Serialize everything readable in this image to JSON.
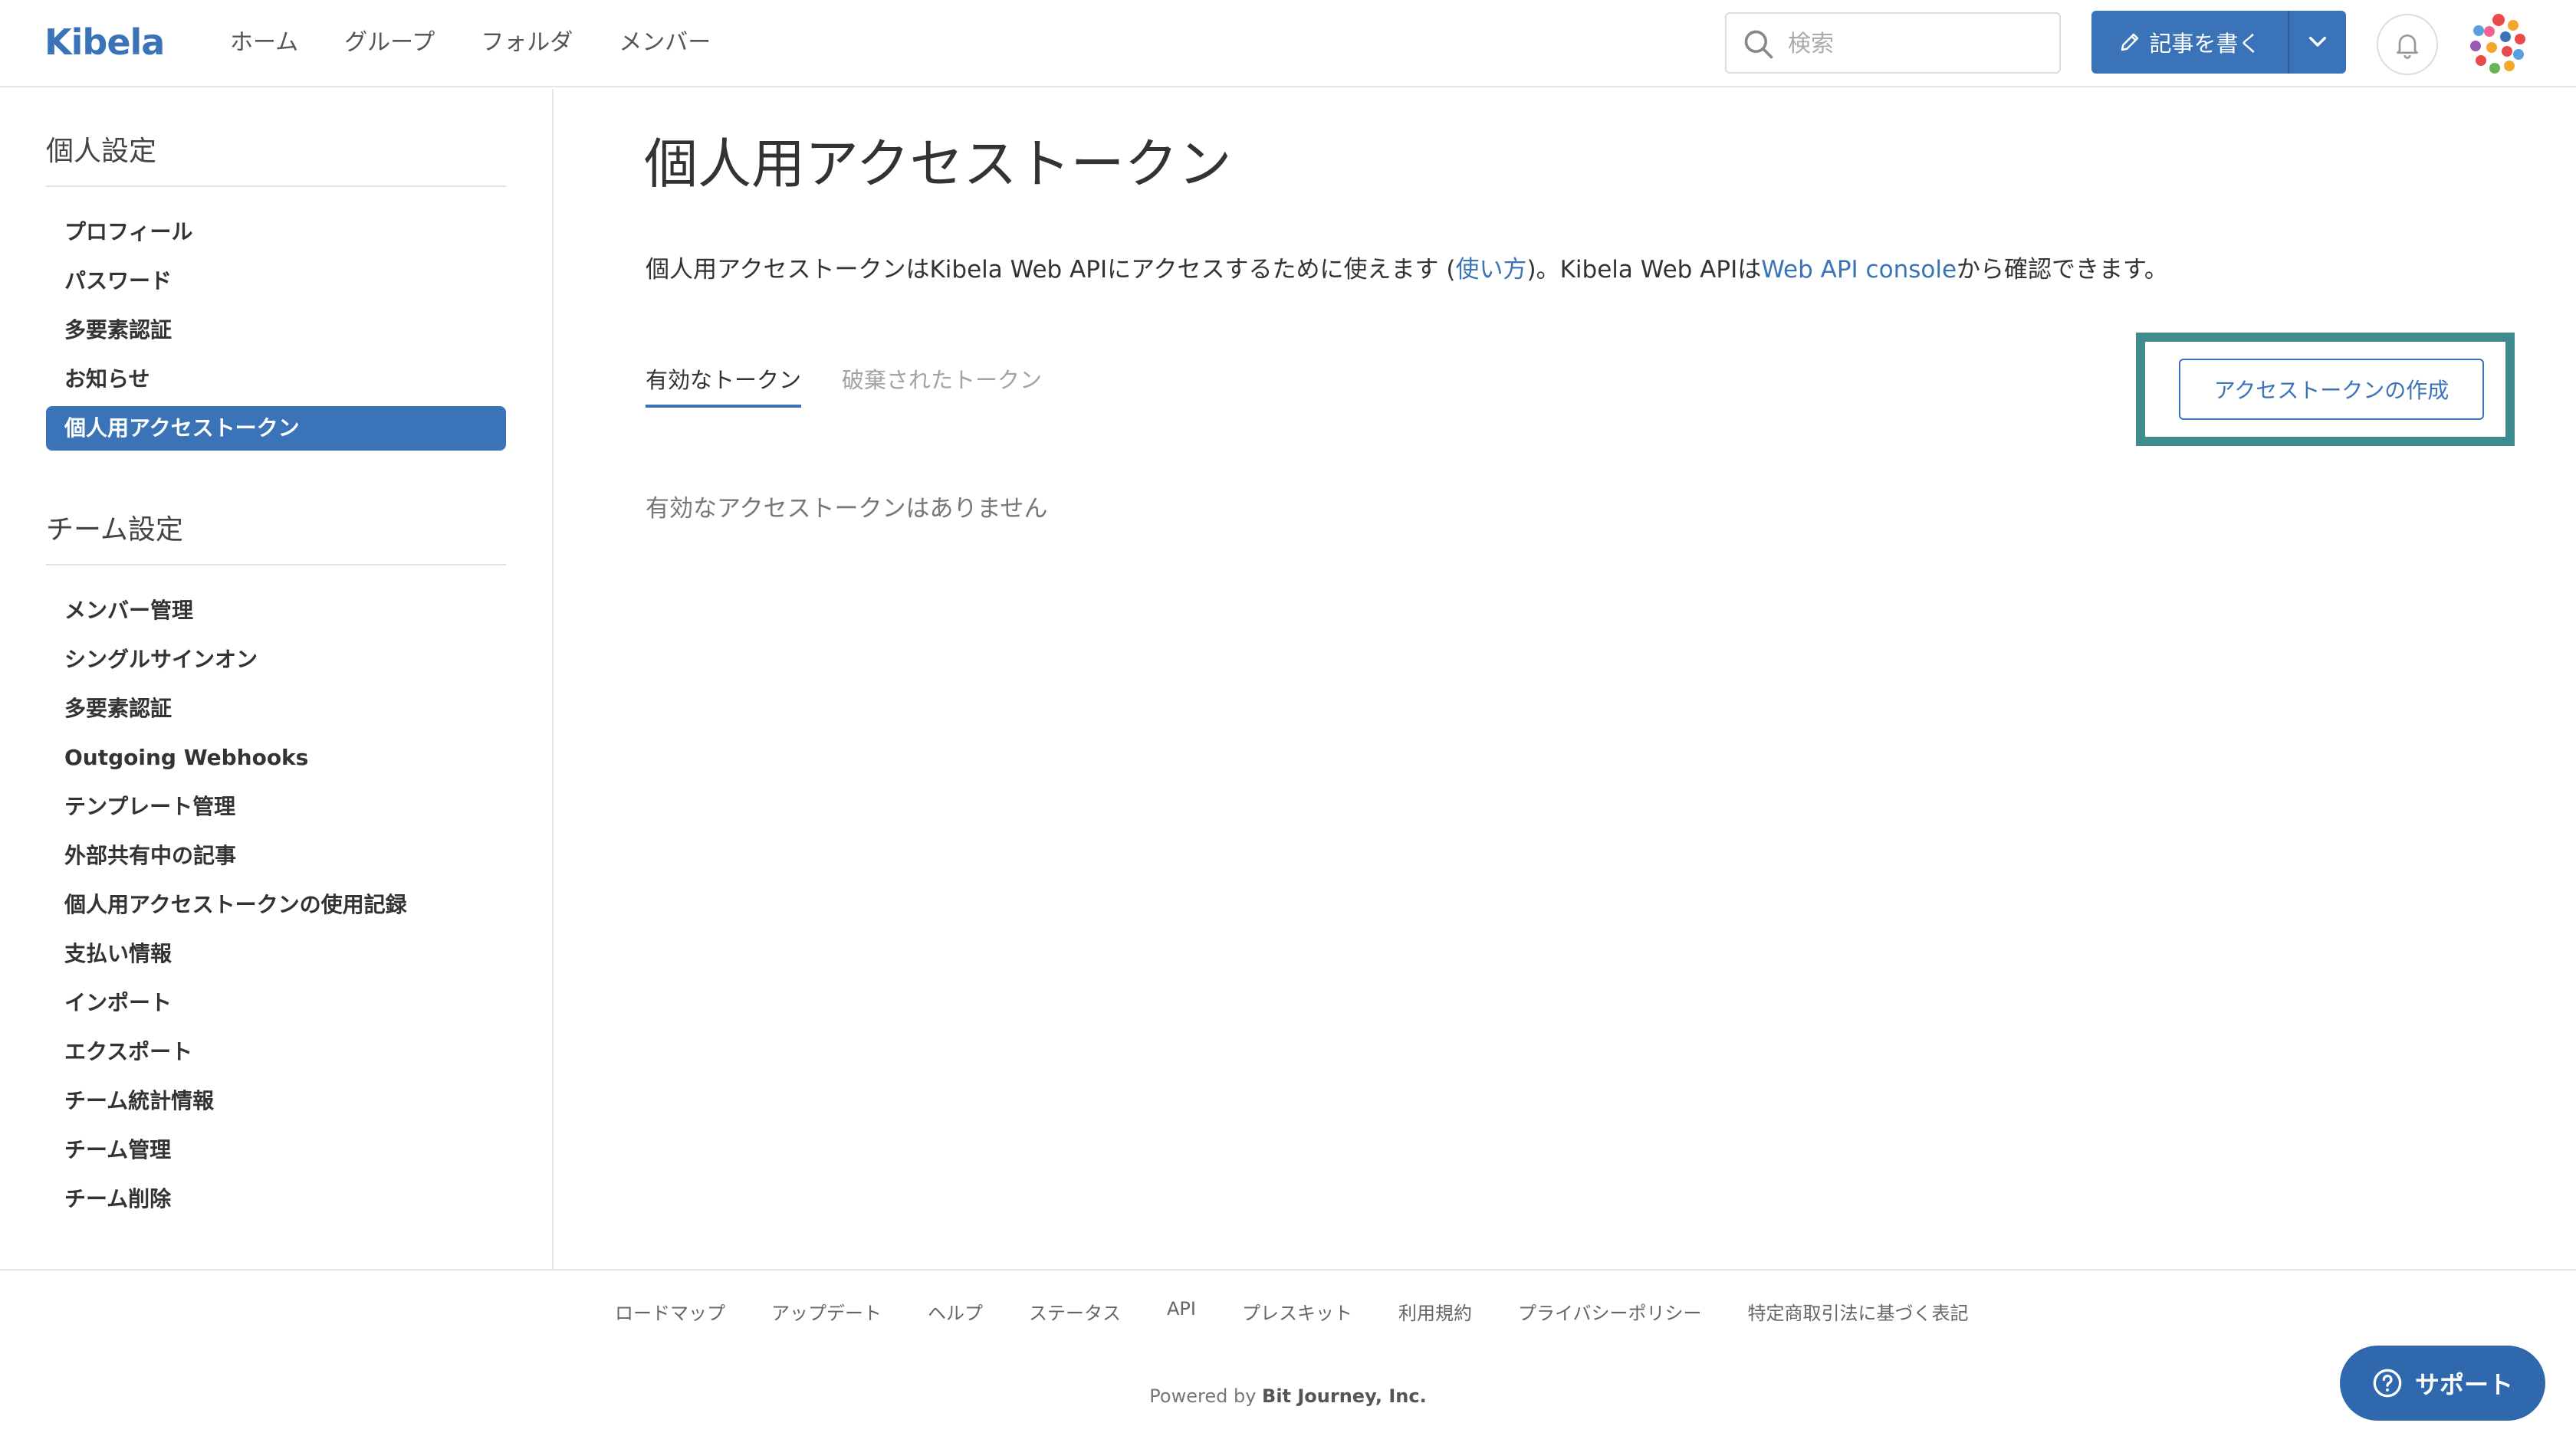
{
  "header": {
    "logo": "Kibela",
    "nav": [
      "ホーム",
      "グループ",
      "フォルダ",
      "メンバー"
    ],
    "search_placeholder": "検索",
    "write_label": "記事を書く"
  },
  "sidebar": {
    "personal_title": "個人設定",
    "personal_items": [
      "プロフィール",
      "パスワード",
      "多要素認証",
      "お知らせ",
      "個人用アクセストークン"
    ],
    "team_title": "チーム設定",
    "team_items": [
      "メンバー管理",
      "シングルサインオン",
      "多要素認証",
      "Outgoing Webhooks",
      "テンプレート管理",
      "外部共有中の記事",
      "個人用アクセストークンの使用記録",
      "支払い情報",
      "インポート",
      "エクスポート",
      "チーム統計情報",
      "チーム管理",
      "チーム削除"
    ]
  },
  "main": {
    "title": "個人用アクセストークン",
    "desc_part1": "個人用アクセストークンはKibela Web APIにアクセスするために使えます (",
    "desc_link1": "使い方",
    "desc_part2": ")。Kibela Web APIは",
    "desc_link2": "Web API console",
    "desc_part3": "から確認できます。",
    "tab_active": "有効なトークン",
    "tab_inactive": "破棄されたトークン",
    "create_button": "アクセストークンの作成",
    "empty_message": "有効なアクセストークンはありません"
  },
  "footer": {
    "links": [
      "ロードマップ",
      "アップデート",
      "ヘルプ",
      "ステータス",
      "API",
      "プレスキット",
      "利用規約",
      "プライバシーポリシー",
      "特定商取引法に基づく表記"
    ],
    "powered_prefix": "Powered by ",
    "powered_company": "Bit Journey, Inc."
  },
  "support_label": "サポート",
  "colors": {
    "accent": "#3b73b9",
    "highlight": "#3f8a8c"
  }
}
